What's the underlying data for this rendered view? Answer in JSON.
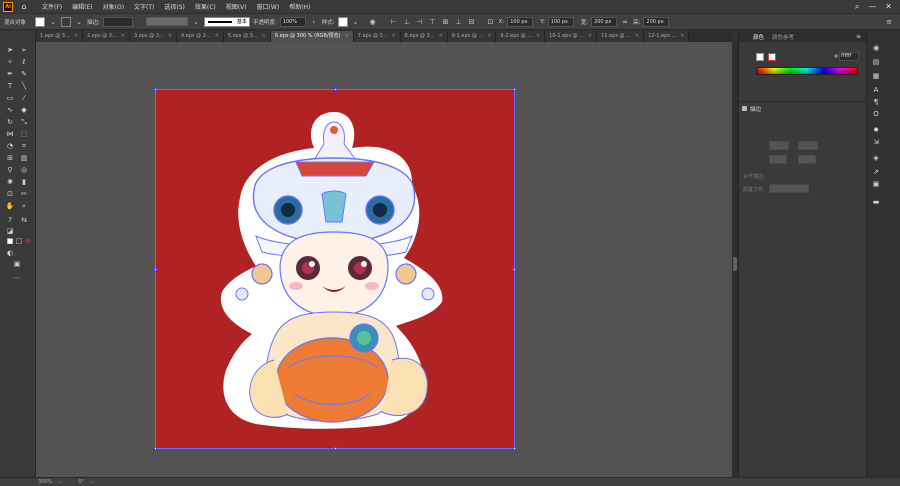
{
  "app": {
    "logo_text": "Ai"
  },
  "menu": [
    "文件(F)",
    "编辑(E)",
    "对象(O)",
    "文字(T)",
    "选择(S)",
    "效果(C)",
    "视图(V)",
    "窗口(W)",
    "帮助(H)"
  ],
  "control_bar": {
    "selection_label": "混合对象",
    "stroke_label": "描边:",
    "stroke_style": "基本",
    "opacity_label": "不透明度:",
    "opacity_value": "100%",
    "style_label": "样式:",
    "x_label": "X:",
    "x_value": "100 px",
    "y_label": "Y:",
    "y_value": "100 px",
    "w_label": "宽:",
    "w_value": "200 px",
    "h_label": "高:",
    "h_value": "200 px"
  },
  "tabs": [
    {
      "label": "1.eps @ 3...",
      "active": false
    },
    {
      "label": "2.eps @ 3...",
      "active": false
    },
    {
      "label": "3.eps @ 3...",
      "active": false
    },
    {
      "label": "4.eps @ 2...",
      "active": false
    },
    {
      "label": "5.eps @ 3...",
      "active": false
    },
    {
      "label": "6.eps @ 300 % (RGB/预览)",
      "active": true
    },
    {
      "label": "7.eps @ 3...",
      "active": false
    },
    {
      "label": "8.eps @ 3...",
      "active": false
    },
    {
      "label": "9-1.eps @ ...",
      "active": false
    },
    {
      "label": "9-2.eps @ ...",
      "active": false
    },
    {
      "label": "10-1.eps @ ...",
      "active": false
    },
    {
      "label": "11.eps @ ...",
      "active": false
    },
    {
      "label": "12-1.eps ...",
      "active": false
    }
  ],
  "right_panel": {
    "tab_color": "颜色",
    "tab_color_guide": "颜色参考",
    "hex_value": "ffffff",
    "section_stroke": "描边",
    "align_label": "对齐描边:",
    "profile_label": "配置文件:"
  },
  "status": {
    "zoom": "300%",
    "angle": "0°"
  },
  "colors": {
    "artboard": "#b12225",
    "accent": "#ff9a00"
  }
}
